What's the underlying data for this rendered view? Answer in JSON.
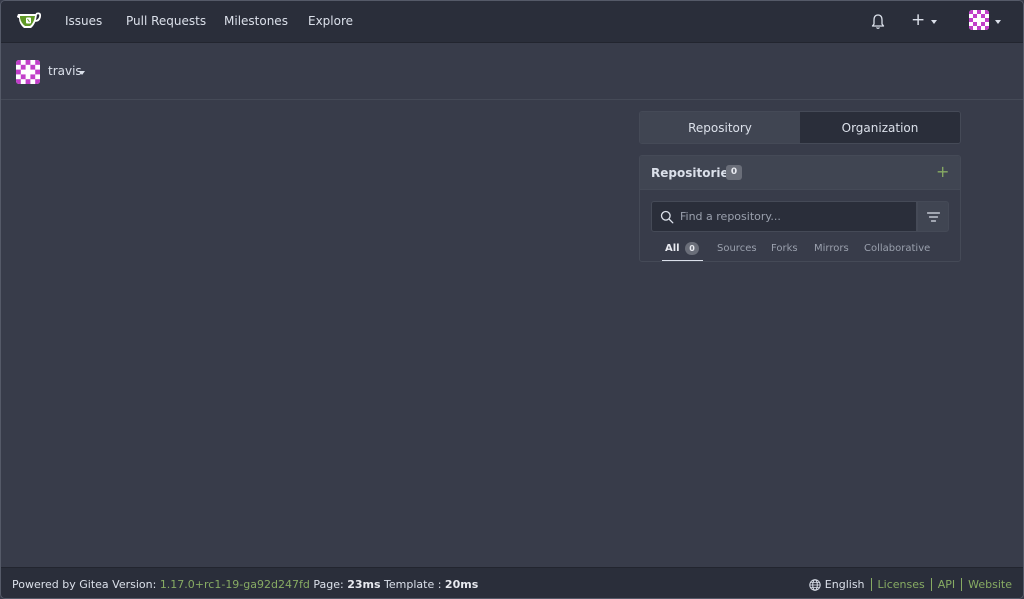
{
  "navbar": {
    "items": [
      {
        "label": "Issues"
      },
      {
        "label": "Pull Requests"
      },
      {
        "label": "Milestones"
      },
      {
        "label": "Explore"
      }
    ],
    "plus_label": "+"
  },
  "context": {
    "username": "travis"
  },
  "dashboard": {
    "tabs": [
      {
        "label": "Repository",
        "active": true
      },
      {
        "label": "Organization",
        "active": false
      }
    ],
    "repos": {
      "title": "Repositories",
      "count": "0",
      "add_label": "+",
      "search_placeholder": "Find a repository...",
      "filters": [
        {
          "label": "All",
          "count": "0",
          "active": true
        },
        {
          "label": "Sources"
        },
        {
          "label": "Forks"
        },
        {
          "label": "Mirrors"
        },
        {
          "label": "Collaborative"
        }
      ]
    }
  },
  "footer": {
    "powered_by": "Powered by Gitea Version:",
    "version": "1.17.0+rc1-19-ga92d247fd",
    "page_label": "Page:",
    "page_time": "23ms",
    "template_label": "Template :",
    "template_time": "20ms",
    "language": "English",
    "links": [
      "Licenses",
      "API",
      "Website"
    ]
  },
  "colors": {
    "background": "#383c4a",
    "navbar": "#2a2e3a",
    "accent_green": "#87ab63",
    "avatar_purple": "#c13ec9"
  },
  "icons": {
    "logo": "gitea-teacup-icon",
    "bell": "bell-icon",
    "avatar": "identicon-avatar",
    "search": "search-icon",
    "filter": "filter-icon",
    "globe": "globe-icon"
  }
}
